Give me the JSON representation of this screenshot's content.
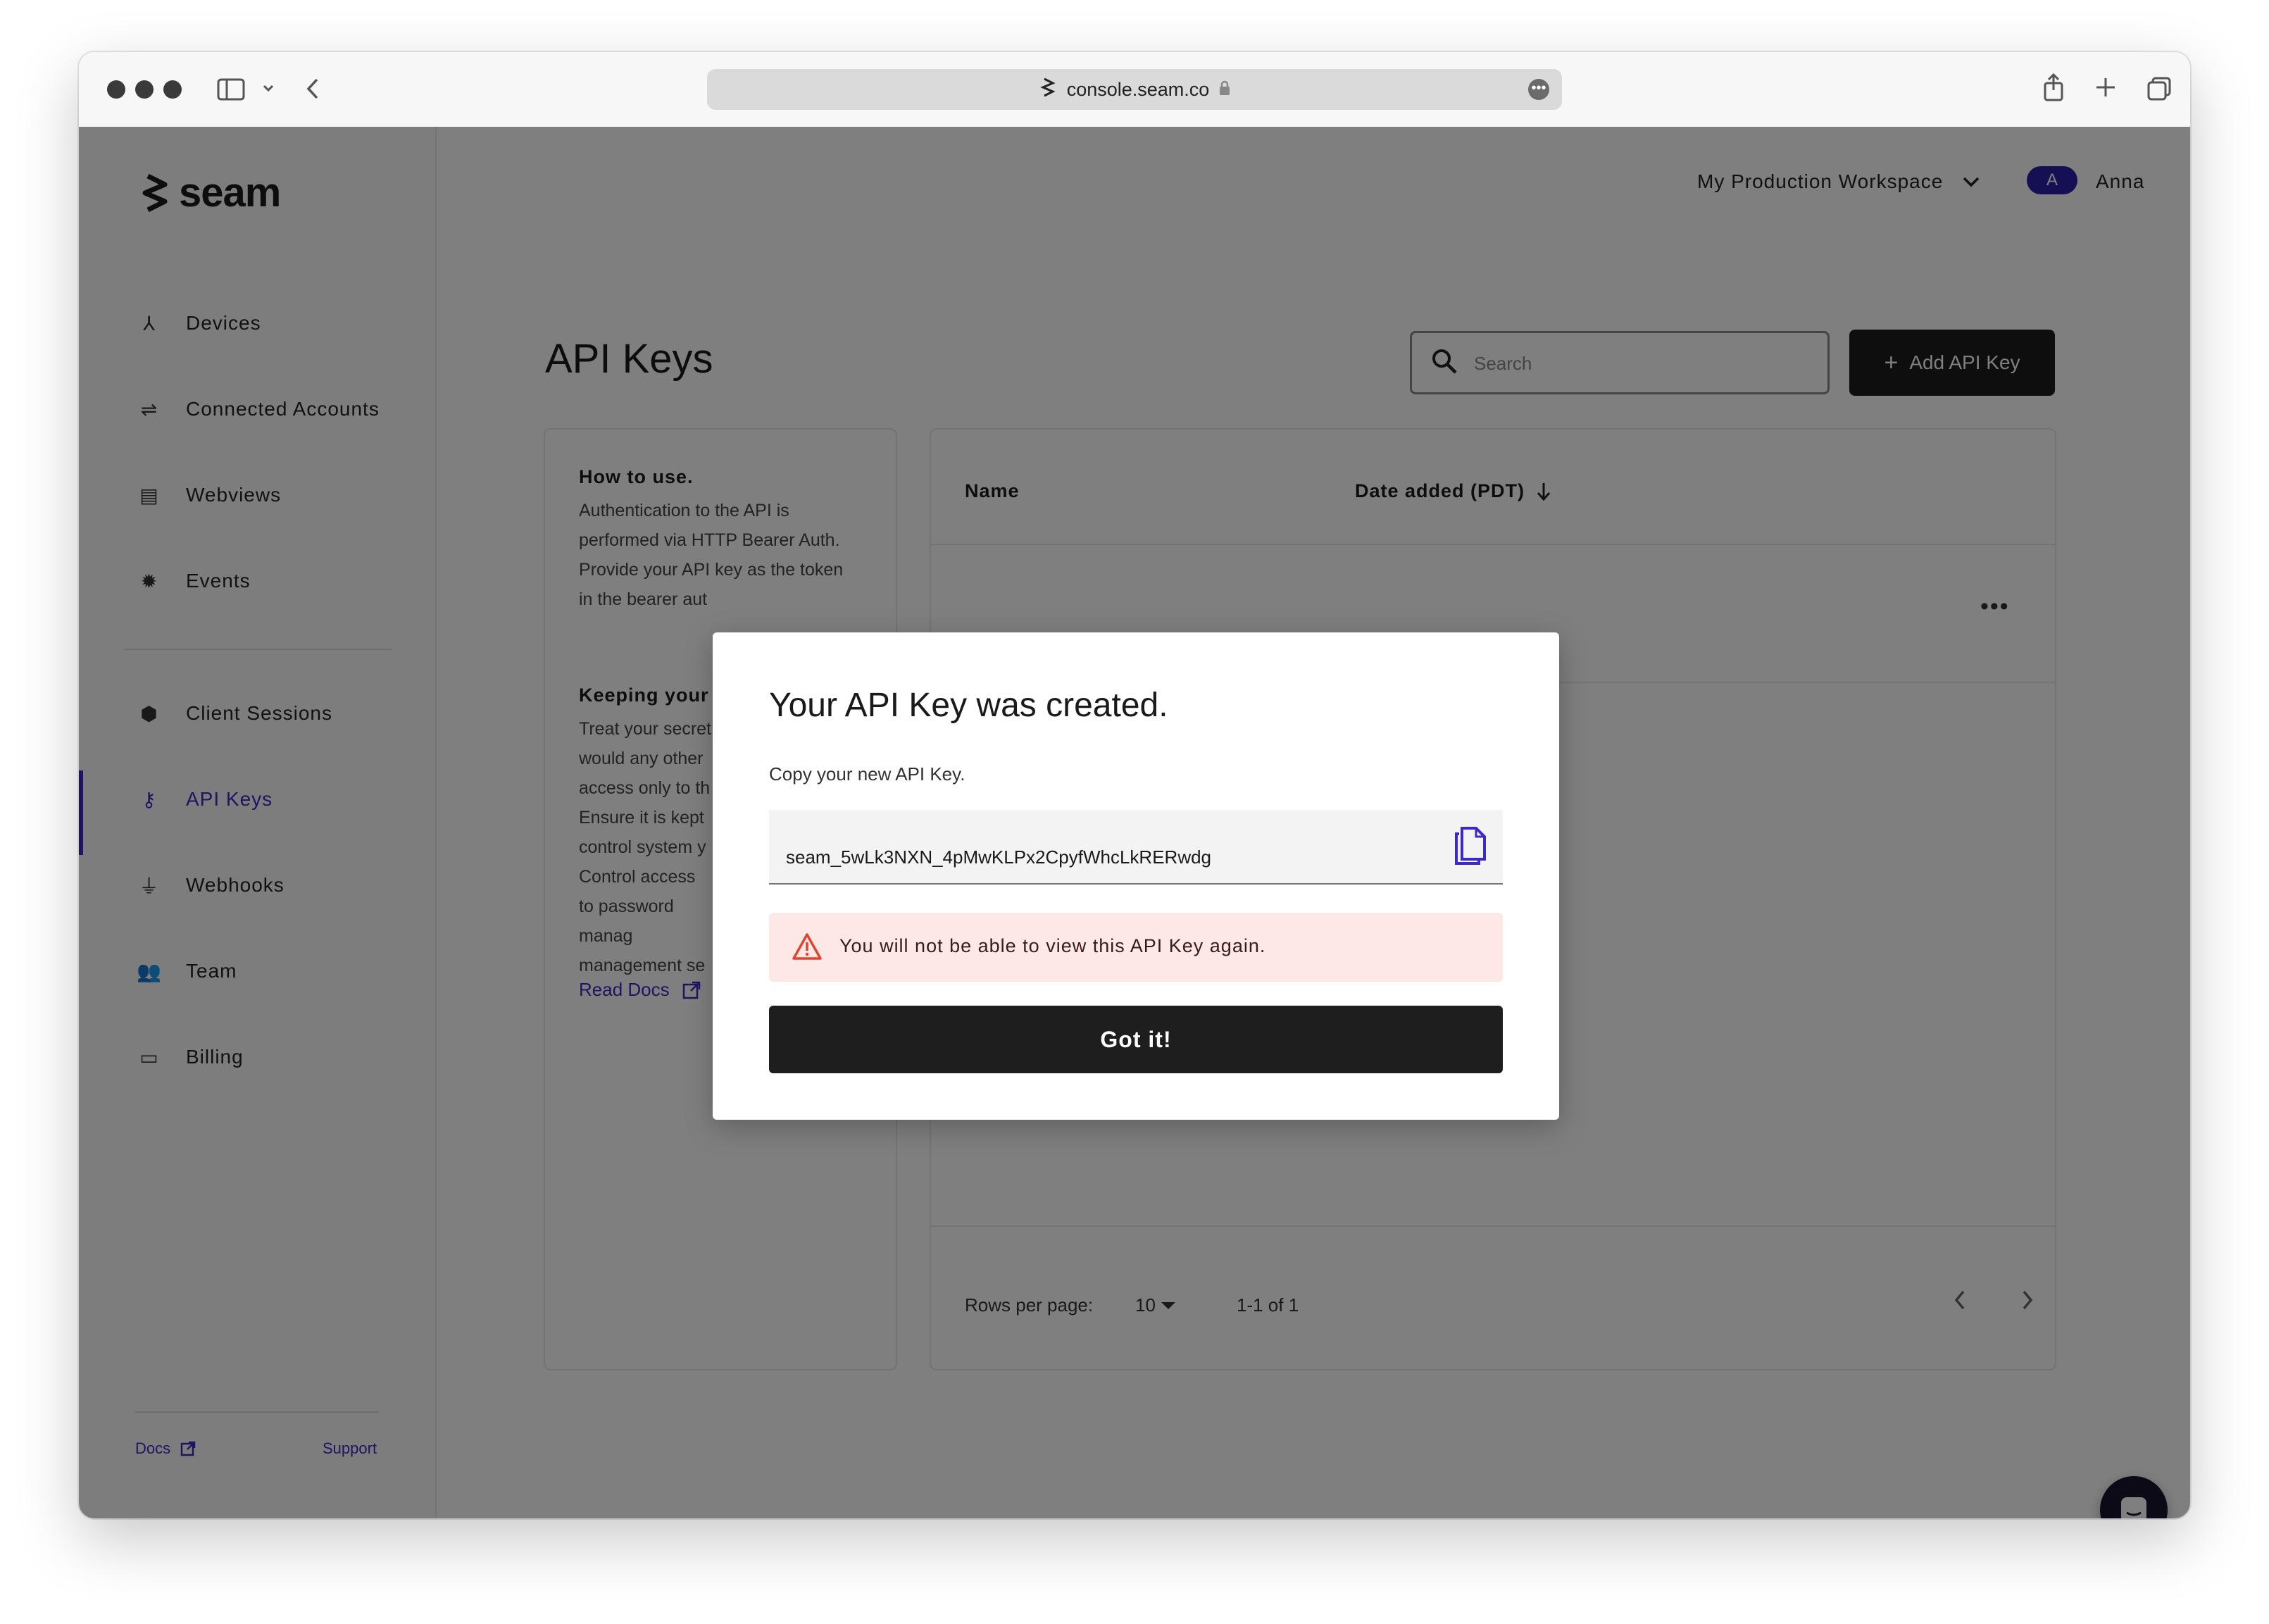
{
  "browser": {
    "url": "console.seam.co"
  },
  "brand": {
    "name": "seam"
  },
  "sidebar": {
    "items": [
      {
        "label": "Devices",
        "icon": "devices-icon"
      },
      {
        "label": "Connected Accounts",
        "icon": "connected-accounts-icon"
      },
      {
        "label": "Webviews",
        "icon": "webviews-icon"
      },
      {
        "label": "Events",
        "icon": "events-icon"
      },
      {
        "label": "Client Sessions",
        "icon": "client-sessions-icon"
      },
      {
        "label": "API Keys",
        "icon": "key-icon",
        "active": true
      },
      {
        "label": "Webhooks",
        "icon": "webhooks-icon"
      },
      {
        "label": "Team",
        "icon": "team-icon"
      },
      {
        "label": "Billing",
        "icon": "billing-icon"
      }
    ],
    "footer": {
      "docs": "Docs",
      "support": "Support"
    }
  },
  "header": {
    "workspace": "My Production Workspace",
    "avatar_initial": "A",
    "user": "Anna"
  },
  "main": {
    "title": "API Keys",
    "search_placeholder": "Search",
    "add_button": "Add API Key",
    "info": {
      "heading1": "How to use.",
      "text1": "Authentication to the API is performed via HTTP Bearer Auth. Provide your API key as the token in the bearer aut",
      "heading2": "Keeping your l",
      "text2": "Treat your secret would any other access only to th Ensure it is kept control system y Control access to password manag management se",
      "read_docs": "Read Docs"
    },
    "table": {
      "columns": [
        "Name",
        "Date added (PDT)"
      ],
      "row_menu": "•••",
      "rows_per_page_label": "Rows per page:",
      "rows_per_page": "10",
      "range": "1-1 of 1"
    }
  },
  "modal": {
    "title": "Your API Key was created.",
    "subtitle": "Copy your new API Key.",
    "api_key": "seam_5wLk3NXN_4pMwKLPx2CpyfWhcLkRERwdg",
    "warning": "You will not be able to view this API Key again.",
    "button": "Got it!"
  },
  "colors": {
    "accent": "#3b2bc4",
    "warning_bg": "#fde8e6",
    "warning_icon": "#e0442f",
    "button_dark": "#1e1e1e"
  }
}
